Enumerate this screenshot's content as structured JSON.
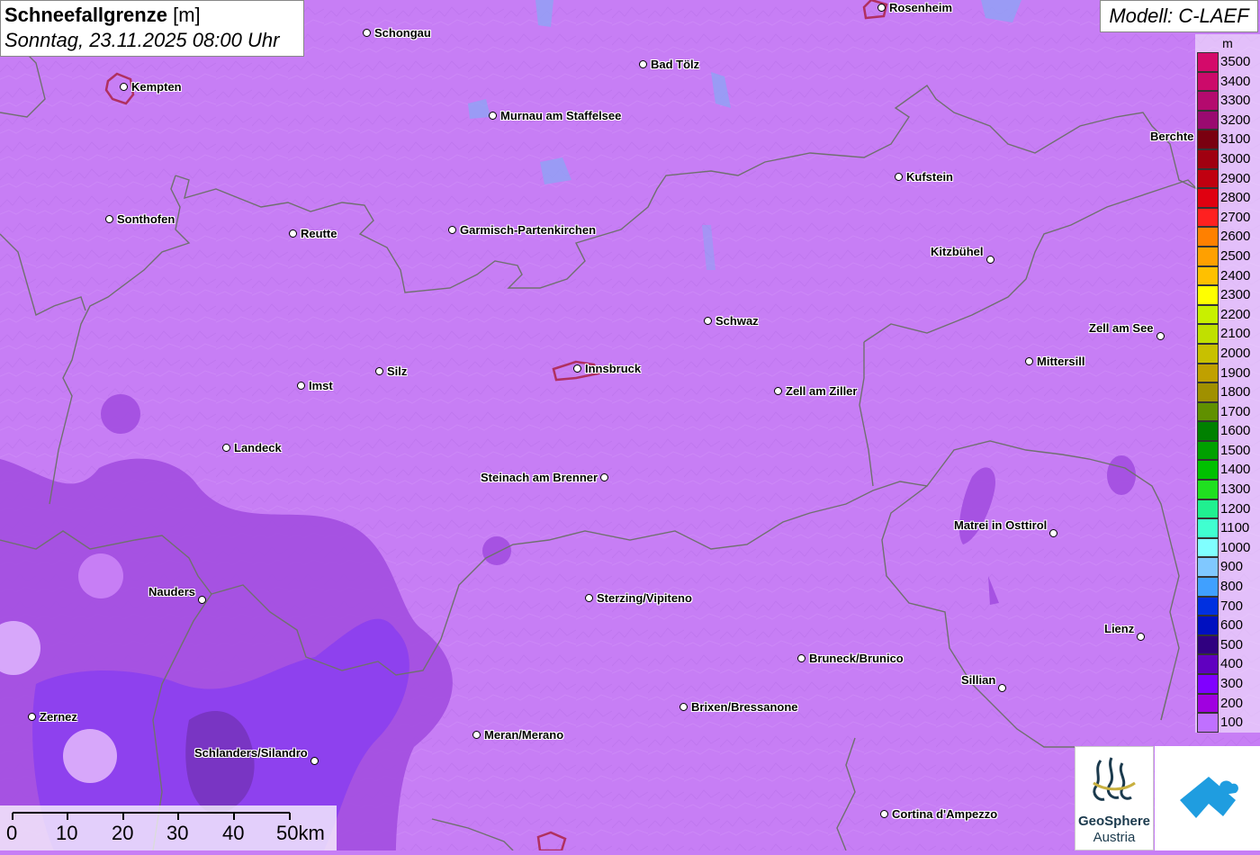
{
  "title": {
    "main": "Schneefallgrenze",
    "unit": "[m]",
    "datetime": "Sonntag, 23.11.2025 08:00 Uhr"
  },
  "model": "Modell: C-LAEF",
  "legend": {
    "unit": "m",
    "levels": [
      {
        "value": "3500",
        "color": "#d40a6a"
      },
      {
        "value": "3400",
        "color": "#cc0a6a"
      },
      {
        "value": "3300",
        "color": "#b40a6e"
      },
      {
        "value": "3200",
        "color": "#9a0a70"
      },
      {
        "value": "3100",
        "color": "#7a0010"
      },
      {
        "value": "3000",
        "color": "#a00010"
      },
      {
        "value": "2900",
        "color": "#c00010"
      },
      {
        "value": "2800",
        "color": "#e00010"
      },
      {
        "value": "2700",
        "color": "#ff2020"
      },
      {
        "value": "2600",
        "color": "#ff8000"
      },
      {
        "value": "2500",
        "color": "#ffa000"
      },
      {
        "value": "2400",
        "color": "#ffc000"
      },
      {
        "value": "2300",
        "color": "#ffff00"
      },
      {
        "value": "2200",
        "color": "#c8f000"
      },
      {
        "value": "2100",
        "color": "#c0e000"
      },
      {
        "value": "2000",
        "color": "#c8c000"
      },
      {
        "value": "1900",
        "color": "#c0a000"
      },
      {
        "value": "1800",
        "color": "#a09000"
      },
      {
        "value": "1700",
        "color": "#609000"
      },
      {
        "value": "1600",
        "color": "#008000"
      },
      {
        "value": "1500",
        "color": "#00a000"
      },
      {
        "value": "1400",
        "color": "#00c000"
      },
      {
        "value": "1300",
        "color": "#20e020"
      },
      {
        "value": "1200",
        "color": "#20f090"
      },
      {
        "value": "1100",
        "color": "#40ffd0"
      },
      {
        "value": "1000",
        "color": "#80ffff"
      },
      {
        "value": "900",
        "color": "#80c8ff"
      },
      {
        "value": "800",
        "color": "#40a0ff"
      },
      {
        "value": "700",
        "color": "#0030e0"
      },
      {
        "value": "600",
        "color": "#0010c0"
      },
      {
        "value": "500",
        "color": "#300080"
      },
      {
        "value": "400",
        "color": "#6000c0"
      },
      {
        "value": "300",
        "color": "#8000ff"
      },
      {
        "value": "200",
        "color": "#a000e0"
      },
      {
        "value": "100",
        "color": "#c070ff"
      }
    ]
  },
  "colors": {
    "background": "#c77ef5",
    "border_line": "#707070",
    "highlight_city": "#b03060"
  },
  "cities": [
    {
      "name": "Rosenheim"
    },
    {
      "name": "Schongau"
    },
    {
      "name": "Kempten"
    },
    {
      "name": "Bad Tölz"
    },
    {
      "name": "Murnau am Staffelsee"
    },
    {
      "name": "Berchte"
    },
    {
      "name": "Kufstein"
    },
    {
      "name": "Sonthofen"
    },
    {
      "name": "Reutte"
    },
    {
      "name": "Garmisch-Partenkirchen"
    },
    {
      "name": "Kitzbühel"
    },
    {
      "name": "Schwaz"
    },
    {
      "name": "Zell am See"
    },
    {
      "name": "Mittersill"
    },
    {
      "name": "Innsbruck"
    },
    {
      "name": "Silz"
    },
    {
      "name": "Imst"
    },
    {
      "name": "Zell am Ziller"
    },
    {
      "name": "Landeck"
    },
    {
      "name": "Steinach am Brenner"
    },
    {
      "name": "Matrei in Osttirol"
    },
    {
      "name": "Nauders"
    },
    {
      "name": "Sterzing/Vipiteno"
    },
    {
      "name": "Lienz"
    },
    {
      "name": "Bruneck/Brunico"
    },
    {
      "name": "Sillian"
    },
    {
      "name": "Brixen/Bressanone"
    },
    {
      "name": "Zernez"
    },
    {
      "name": "Meran/Merano"
    },
    {
      "name": "Schlanders/Silandro"
    },
    {
      "name": "Cortina d'Ampezzo"
    }
  ],
  "scale_bar": {
    "labels": [
      "0",
      "10",
      "20",
      "30",
      "40",
      "50km"
    ]
  },
  "logos": {
    "geosphere_line1": "GeoSphere",
    "geosphere_line2": "Austria"
  }
}
